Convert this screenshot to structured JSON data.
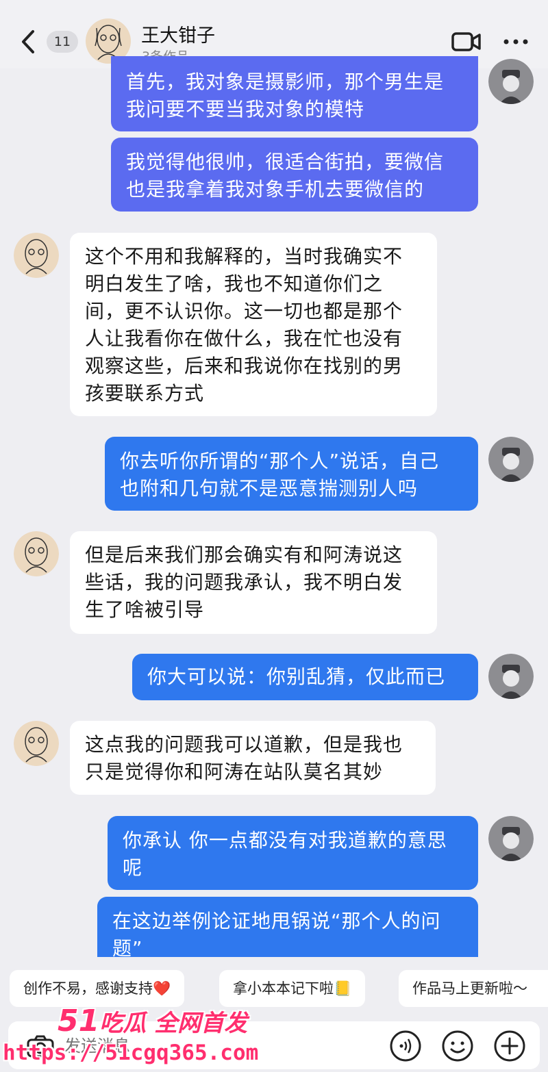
{
  "header": {
    "unread_count": "11",
    "contact_name": "王大钳子",
    "contact_subtitle": "3条作品"
  },
  "messages": [
    {
      "side": "out",
      "text": "首先，我对象是摄影师，那个男生是我问要不要当我对象的模特"
    },
    {
      "side": "out",
      "text": "我觉得他很帅，很适合街拍，要微信也是我拿着我对象手机去要微信的"
    },
    {
      "side": "in",
      "text": "这个不用和我解释的，当时我确实不明白发生了啥，我也不知道你们之间，更不认识你。这一切也都是那个人让我看你在做什么，我在忙也没有观察这些，后来和我说你在找别的男孩要联系方式"
    },
    {
      "side": "out",
      "text": "你去听你所谓的“那个人”说话，自己也附和几句就不是恶意揣测别人吗"
    },
    {
      "side": "in",
      "text": "但是后来我们那会确实有和阿涛说这些话，我的问题我承认，我不明白发生了啥被引导"
    },
    {
      "side": "out",
      "text": "你大可以说：你别乱猜，仅此而已"
    },
    {
      "side": "in",
      "text": "这点我的问题我可以道歉，但是我也只是觉得你和阿涛在站队莫名其妙"
    },
    {
      "side": "out",
      "text": "你承认 你一点都没有对我道歉的意思呢"
    },
    {
      "side": "out",
      "text": "在这边举例论证地甩锅说“那个人的问题”"
    }
  ],
  "message_lines": {
    "m0": [
      "首先，我对象是摄影师，那个男生是",
      "我问要不要当我对象的模特"
    ],
    "m1": [
      "我觉得他很帅，很适合街拍，要微信",
      "也是我拿着我对象手机去要微信的"
    ],
    "m2": [
      "这个不用和我解释的，当时我确实不",
      "明白发生了啥，我也不知道你们之",
      "间，更不认识你。这一切也都是那个",
      "人让我看你在做什么，我在忙也没有",
      "观察这些，后来和我说你在找别的男",
      "孩要联系方式"
    ],
    "m3": [
      "你去听你所谓的“那个人”说话，自己",
      "也附和几句就不是恶意揣测别人吗"
    ],
    "m4": [
      "但是后来我们那会确实有和阿涛说这",
      "些话，我的问题我承认，我不明白发",
      "生了啥被引导"
    ],
    "m5": [
      "你大可以说：你别乱猜，仅此而已"
    ],
    "m6": [
      "这点我的问题我可以道歉，但是我也",
      "只是觉得你和阿涛在站队莫名其妙"
    ],
    "m7": [
      "你承认 你一点都没有对我道歉的意思",
      "呢"
    ],
    "m8": [
      "在这边举例论证地甩锅说“那个人的问",
      "题”"
    ]
  },
  "quick_replies": [
    "创作不易，感谢支持❤️",
    "拿小本本记下啦📒",
    "作品马上更新啦～"
  ],
  "input": {
    "placeholder": "发送消息"
  },
  "watermark": {
    "brand_num": "51",
    "brand_text": "吃瓜 全网首发",
    "url": "https://51cgq365.com"
  },
  "colors": {
    "outgoing_bubble": "#2f78ee",
    "outgoing_bubble_purple": "#5b6bf0",
    "incoming_bubble": "#ffffff",
    "background": "#eeeef2",
    "watermark": "#ff2e6e"
  },
  "icons": [
    "back-icon",
    "video-call-icon",
    "more-icon",
    "camera-icon",
    "voice-icon",
    "emoji-icon",
    "plus-icon"
  ]
}
